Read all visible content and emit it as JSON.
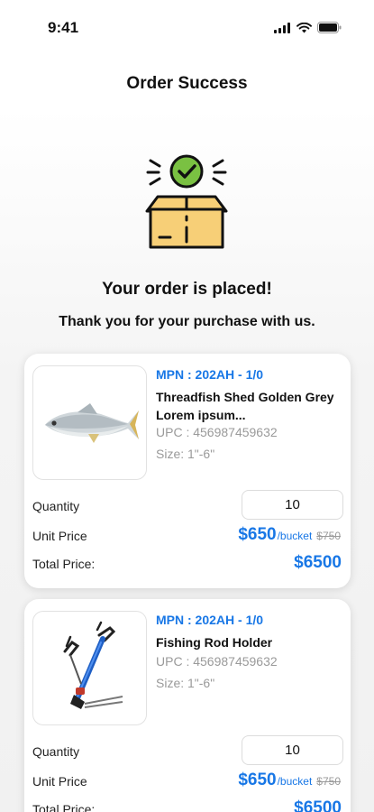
{
  "status_bar": {
    "time": "9:41"
  },
  "header": {
    "title": "Order Success"
  },
  "hero": {
    "icon": "package-success-icon"
  },
  "message": {
    "title": "Your order is placed!",
    "subtitle": "Thank you for your purchase with us."
  },
  "labels": {
    "quantity": "Quantity",
    "unit_price": "Unit Price",
    "total_price": "Total Price:"
  },
  "items": [
    {
      "mpn": "MPN : 202AH - 1/0",
      "name": "Threadfish Shed  Golden Grey Lorem ipsum...",
      "upc": "UPC : 456987459632",
      "size": "Size: 1\"-6\"",
      "quantity": "10",
      "unit_price": "$650",
      "unit": "/bucket",
      "old_price": "$750",
      "total": "$6500",
      "image": "fish-image"
    },
    {
      "mpn": "MPN : 202AH - 1/0",
      "name": "Fishing Rod Holder",
      "upc": "UPC : 456987459632",
      "size": "Size: 1\"-6\"",
      "quantity": "10",
      "unit_price": "$650",
      "unit": "/bucket",
      "old_price": "$750",
      "total": "$6500",
      "image": "rod-holder-image"
    }
  ],
  "colors": {
    "accent": "#1877e6",
    "success": "#7ac142",
    "box": "#f7cf77"
  }
}
